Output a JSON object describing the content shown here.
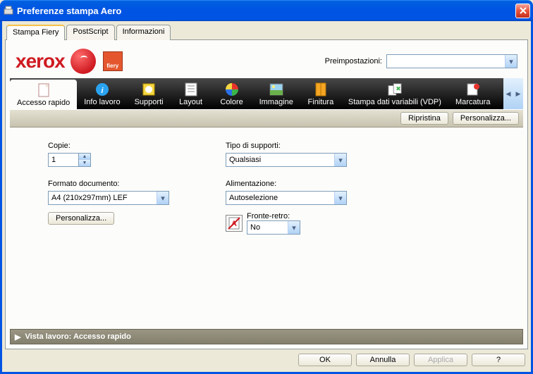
{
  "window": {
    "title": "Preferenze stampa Aero"
  },
  "tabs": [
    {
      "label": "Stampa Fiery",
      "active": true
    },
    {
      "label": "PostScript",
      "active": false
    },
    {
      "label": "Informazioni",
      "active": false
    }
  ],
  "brand": {
    "logo_text": "xerox",
    "fiery_text": "fiery"
  },
  "presets": {
    "label": "Preimpostazioni:",
    "value": ""
  },
  "toolbar": {
    "items": [
      {
        "label": "Accesso rapido",
        "icon": "doc",
        "active": true
      },
      {
        "label": "Info lavoro",
        "icon": "info",
        "active": false
      },
      {
        "label": "Supporti",
        "icon": "stamp",
        "active": false
      },
      {
        "label": "Layout",
        "icon": "layout",
        "active": false
      },
      {
        "label": "Colore",
        "icon": "color",
        "active": false
      },
      {
        "label": "Immagine",
        "icon": "image",
        "active": false
      },
      {
        "label": "Finitura",
        "icon": "booklet",
        "active": false
      },
      {
        "label": "Stampa dati variabili (VDP)",
        "icon": "vdp",
        "active": false
      },
      {
        "label": "Marcatura",
        "icon": "stamp2",
        "active": false
      }
    ]
  },
  "subbar": {
    "reset": "Ripristina",
    "customize": "Personalizza..."
  },
  "form": {
    "copies": {
      "label": "Copie:",
      "value": "1"
    },
    "doc_format": {
      "label": "Formato documento:",
      "value": "A4 (210x297mm) LEF",
      "customize": "Personalizza..."
    },
    "media_type": {
      "label": "Tipo di supporti:",
      "value": "Qualsiasi"
    },
    "feed": {
      "label": "Alimentazione:",
      "value": "Autoselezione"
    },
    "duplex": {
      "label": "Fronte-retro:",
      "value": "No"
    }
  },
  "vista": {
    "label": "Vista lavoro: Accesso rapido"
  },
  "buttons": {
    "ok": "OK",
    "cancel": "Annulla",
    "apply": "Applica",
    "help": "?"
  }
}
